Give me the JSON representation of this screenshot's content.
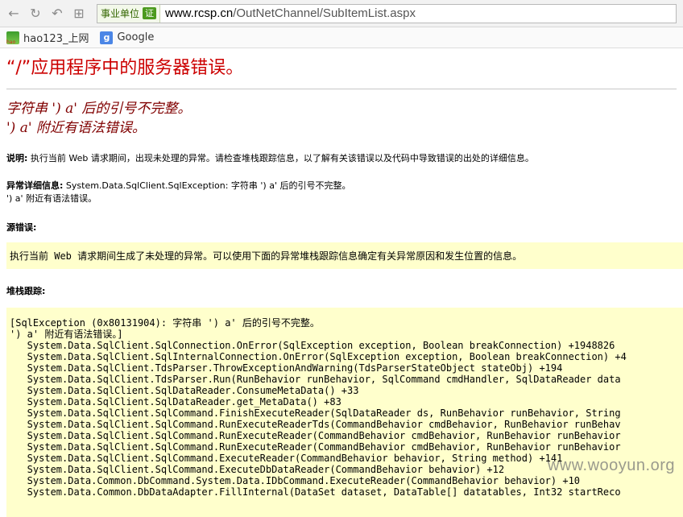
{
  "browser": {
    "org_label": "事业单位",
    "org_badge": "证",
    "url_host": "www.rcsp.cn",
    "url_path": "/OutNetChannel/SubItemList.aspx",
    "bookmarks": [
      {
        "label": "hao123_上网",
        "icon": "hao123-icon"
      },
      {
        "label": "Google",
        "icon": "google-icon"
      }
    ]
  },
  "page": {
    "title": "“/”应用程序中的服务器错误。",
    "error_line1": "字符串 ') a' 后的引号不完整。",
    "error_line2": "') a' 附近有语法错误。",
    "desc_label": "说明:",
    "desc_text": " 执行当前 Web 请求期间，出现未处理的异常。请检查堆栈跟踪信息，以了解有关该错误以及代码中导致错误的出处的详细信息。",
    "exc_label": "异常详细信息:",
    "exc_text": " System.Data.SqlClient.SqlException: 字符串 ') a' 后的引号不完整。",
    "exc_text2": "') a' 附近有语法错误。",
    "source_label": "源错误:",
    "source_note": "执行当前 Web 请求期间生成了未处理的异常。可以使用下面的异常堆栈跟踪信息确定有关异常原因和发生位置的信息。",
    "stack_label": "堆栈跟踪:",
    "stack_lines": [
      "[SqlException (0x80131904): 字符串 ') a' 后的引号不完整。",
      "') a' 附近有语法错误。]",
      "   System.Data.SqlClient.SqlConnection.OnError(SqlException exception, Boolean breakConnection) +1948826",
      "   System.Data.SqlClient.SqlInternalConnection.OnError(SqlException exception, Boolean breakConnection) +4",
      "   System.Data.SqlClient.TdsParser.ThrowExceptionAndWarning(TdsParserStateObject stateObj) +194",
      "   System.Data.SqlClient.TdsParser.Run(RunBehavior runBehavior, SqlCommand cmdHandler, SqlDataReader data",
      "   System.Data.SqlClient.SqlDataReader.ConsumeMetaData() +33",
      "   System.Data.SqlClient.SqlDataReader.get_MetaData() +83",
      "   System.Data.SqlClient.SqlCommand.FinishExecuteReader(SqlDataReader ds, RunBehavior runBehavior, String",
      "   System.Data.SqlClient.SqlCommand.RunExecuteReaderTds(CommandBehavior cmdBehavior, RunBehavior runBehav",
      "   System.Data.SqlClient.SqlCommand.RunExecuteReader(CommandBehavior cmdBehavior, RunBehavior runBehavior",
      "   System.Data.SqlClient.SqlCommand.RunExecuteReader(CommandBehavior cmdBehavior, RunBehavior runBehavior",
      "   System.Data.SqlClient.SqlCommand.ExecuteReader(CommandBehavior behavior, String method) +141",
      "   System.Data.SqlClient.SqlCommand.ExecuteDbDataReader(CommandBehavior behavior) +12",
      "   System.Data.Common.DbCommand.System.Data.IDbCommand.ExecuteReader(CommandBehavior behavior) +10",
      "   System.Data.Common.DbDataAdapter.FillInternal(DataSet dataset, DataTable[] datatables, Int32 startReco"
    ]
  },
  "watermark": "www.wooyun.org"
}
